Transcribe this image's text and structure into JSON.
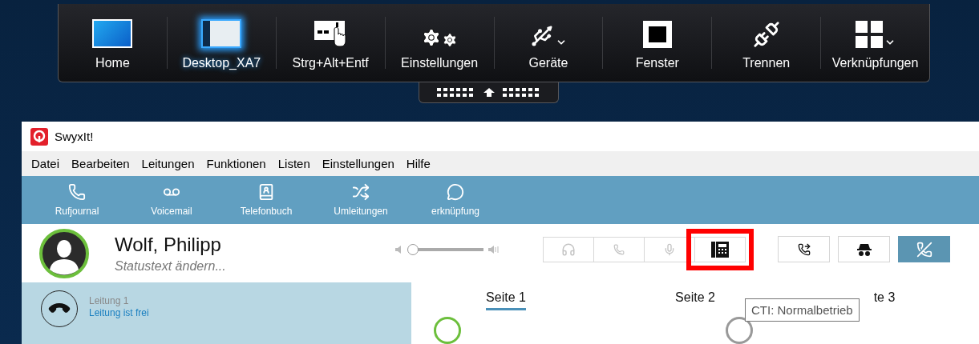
{
  "remote_toolbar": {
    "items": [
      {
        "label": "Home",
        "selected": false,
        "has_menu": false
      },
      {
        "label": "Desktop_XA7",
        "selected": true,
        "has_menu": false
      },
      {
        "label": "Strg+Alt+Entf",
        "selected": false,
        "has_menu": false
      },
      {
        "label": "Einstellungen",
        "selected": false,
        "has_menu": false
      },
      {
        "label": "Geräte",
        "selected": false,
        "has_menu": true
      },
      {
        "label": "Fenster",
        "selected": false,
        "has_menu": false
      },
      {
        "label": "Trennen",
        "selected": false,
        "has_menu": false
      },
      {
        "label": "Verknüpfungen",
        "selected": false,
        "has_menu": true
      }
    ]
  },
  "window": {
    "title": "SwyxIt!"
  },
  "menu": [
    "Datei",
    "Bearbeiten",
    "Leitungen",
    "Funktionen",
    "Listen",
    "Einstellungen",
    "Hilfe"
  ],
  "quick_bar": [
    {
      "label": "Rufjournal"
    },
    {
      "label": "Voicemail"
    },
    {
      "label": "Telefonbuch"
    },
    {
      "label": "Umleitungen"
    },
    {
      "label": "erknüpfung"
    }
  ],
  "user": {
    "name": "Wolf, Philipp",
    "status_placeholder": "Statustext ändern..."
  },
  "volume": {
    "level": 0.04
  },
  "device_buttons": [
    {
      "disabled": true,
      "highlighted": false
    },
    {
      "disabled": true,
      "highlighted": false
    },
    {
      "disabled": true,
      "highlighted": false
    },
    {
      "disabled": false,
      "highlighted": true
    }
  ],
  "action_buttons": [
    {
      "active": false
    },
    {
      "active": false
    },
    {
      "active": true
    }
  ],
  "line": {
    "title": "Leitung 1",
    "status": "Leitung ist frei"
  },
  "tabs": [
    {
      "label": "Seite 1",
      "selected": true
    },
    {
      "label": "Seite 2",
      "selected": false
    },
    {
      "label": "te 3",
      "selected": false
    }
  ],
  "tooltip": "CTI: Normalbetrieb"
}
